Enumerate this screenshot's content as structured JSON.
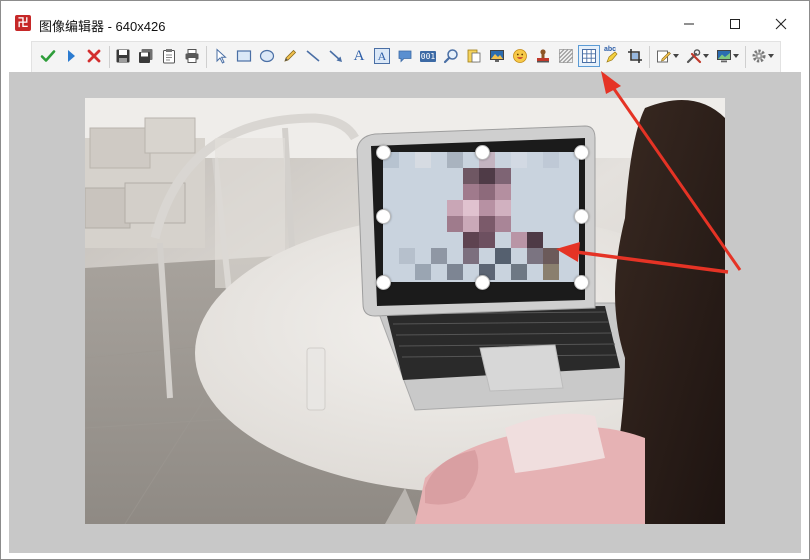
{
  "window": {
    "title": "图像编辑器 - 640x426",
    "app_icon_glyph": "卍"
  },
  "toolbar": {
    "buttons": [
      {
        "name": "confirm-check-icon",
        "color": "#2e9d3a"
      },
      {
        "name": "play-arrow-icon",
        "color": "#2b7bd0"
      },
      {
        "name": "cancel-x-icon",
        "color": "#d32f2f"
      },
      {
        "name": "save-icon"
      },
      {
        "name": "save-as-icon"
      },
      {
        "name": "clipboard-icon"
      },
      {
        "name": "print-icon"
      },
      {
        "name": "select-pointer-icon"
      },
      {
        "name": "rectangle-icon"
      },
      {
        "name": "ellipse-icon"
      },
      {
        "name": "pencil-icon"
      },
      {
        "name": "line-icon"
      },
      {
        "name": "arrow-line-icon"
      },
      {
        "name": "text-tool-icon",
        "label": "A"
      },
      {
        "name": "text-box-icon",
        "label": "A"
      },
      {
        "name": "speech-bubble-icon"
      },
      {
        "name": "counter-icon",
        "label": "001"
      },
      {
        "name": "magnifier-icon"
      },
      {
        "name": "step-icon"
      },
      {
        "name": "image-icon"
      },
      {
        "name": "emoji-icon"
      },
      {
        "name": "stamp-icon"
      },
      {
        "name": "hatch-icon"
      },
      {
        "name": "mosaic-grid-icon",
        "active": true
      },
      {
        "name": "highlighter-icon",
        "label": "abc"
      },
      {
        "name": "crop-icon"
      },
      {
        "name": "edit-menu-icon"
      },
      {
        "name": "tools-menu-icon"
      },
      {
        "name": "display-menu-icon"
      },
      {
        "name": "settings-gear-icon"
      }
    ]
  },
  "canvas": {
    "image_description": "photo of a person at a round white table viewing a laptop, laptop screen region pixelated with mosaic"
  },
  "colors": {
    "annotation_arrow": "#e53325",
    "workspace_bg": "#c8c8c8",
    "active_tool_border": "#5b9bd5"
  }
}
